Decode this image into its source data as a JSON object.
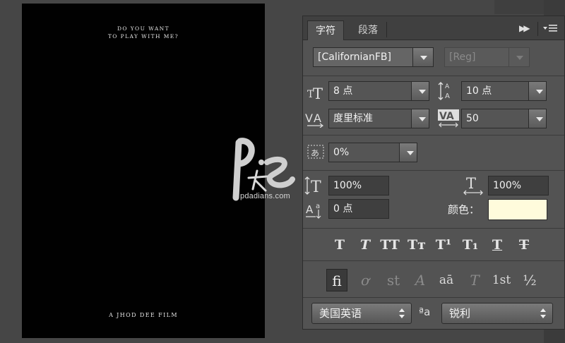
{
  "document": {
    "title_line1": "DO YOU WANT",
    "title_line2": "TO PLAY WITH ME?",
    "footer": "A JHOD DEE FILM"
  },
  "watermark": {
    "text": "pdadians.com"
  },
  "panel": {
    "tabs": [
      {
        "label": "字符",
        "active": true
      },
      {
        "label": "段落",
        "active": false
      }
    ],
    "font_family": "[CalifornianFB]",
    "font_style": "[Reg]",
    "font_size": "8 点",
    "leading": "10 点",
    "kerning": "度里标准",
    "tracking": "50",
    "tsume": "0%",
    "vertical_scale": "100%",
    "horizontal_scale": "100%",
    "baseline_shift": "0 点",
    "color_label": "颜色：",
    "color_value": "#fffbdc",
    "style_buttons": [
      "T",
      "T",
      "TT",
      "Tт",
      "T¹",
      "T₁",
      "T",
      "T"
    ],
    "opentype_buttons": [
      "ﬁ",
      "ơ",
      "st",
      "A",
      "aā",
      "T",
      "1st",
      "½"
    ],
    "language": "美国英语",
    "antialias_icon": "ªa",
    "antialias": "锐利"
  },
  "icons": {
    "collapse": "double-chevron-right-icon",
    "menu": "panel-menu-icon",
    "font_size": "font-size-icon",
    "leading": "leading-icon",
    "kerning": "kerning-icon",
    "tracking": "tracking-icon",
    "tsume": "tsume-icon",
    "vertical_scale": "vertical-scale-icon",
    "horizontal_scale": "horizontal-scale-icon",
    "baseline_shift": "baseline-shift-icon"
  }
}
